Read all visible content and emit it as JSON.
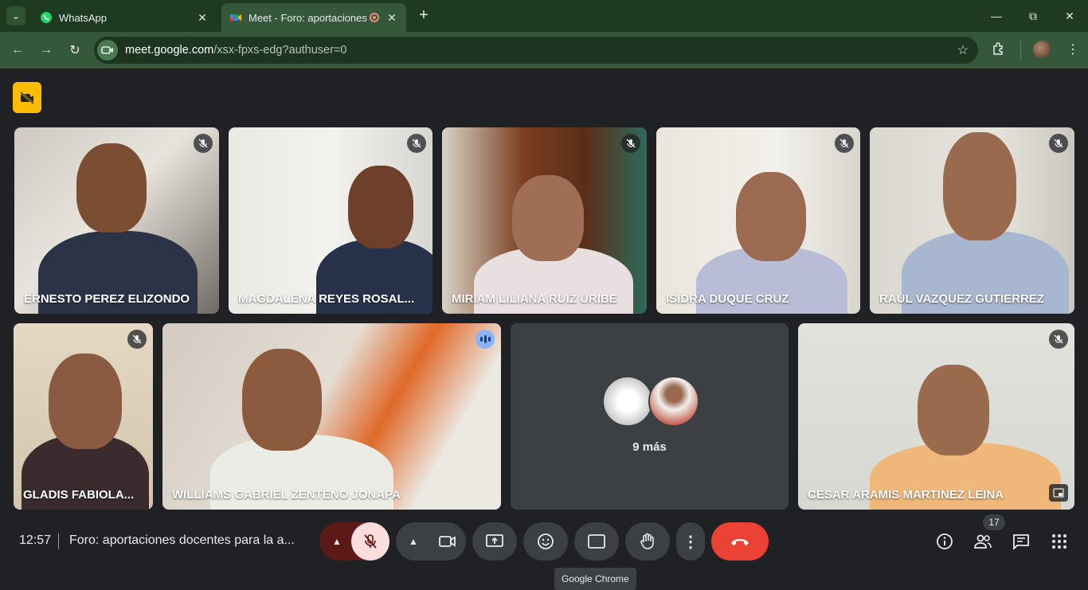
{
  "browser": {
    "tabs": [
      {
        "title": "WhatsApp",
        "favicon": "whatsapp-icon",
        "active": false
      },
      {
        "title": "Meet - Foro: aportaciones d",
        "favicon": "meet-icon",
        "active": true
      }
    ],
    "address": {
      "host": "meet.google.com",
      "path": "/xsx-fpxs-edg?authuser=0"
    }
  },
  "meet": {
    "participants_row1": [
      {
        "name": "ERNESTO PEREZ ELIZONDO",
        "muted": true
      },
      {
        "name": "MAGDALENA REYES ROSAL...",
        "muted": true
      },
      {
        "name": "MIRIAM LILIANA RUIZ URIBE",
        "muted": true
      },
      {
        "name": "ISIDRA DUQUE CRUZ",
        "muted": true
      },
      {
        "name": "RAUL VAZQUEZ GUTIERREZ",
        "muted": true
      }
    ],
    "participants_row2": [
      {
        "name": "GLADIS FABIOLA...",
        "muted": true
      },
      {
        "name": "WILLIAMS GABRIEL ZENTENO JONAPA",
        "muted": false,
        "speaking": true
      },
      {
        "name": "CESAR ARAMIS MARTINEZ LEINA",
        "muted": true
      }
    ],
    "more_tile": {
      "label": "9 más"
    },
    "bottom": {
      "time": "12:57",
      "meeting_title": "Foro: aportaciones docentes para la a...",
      "tooltip": "Google Chrome",
      "people_count": "17"
    }
  }
}
